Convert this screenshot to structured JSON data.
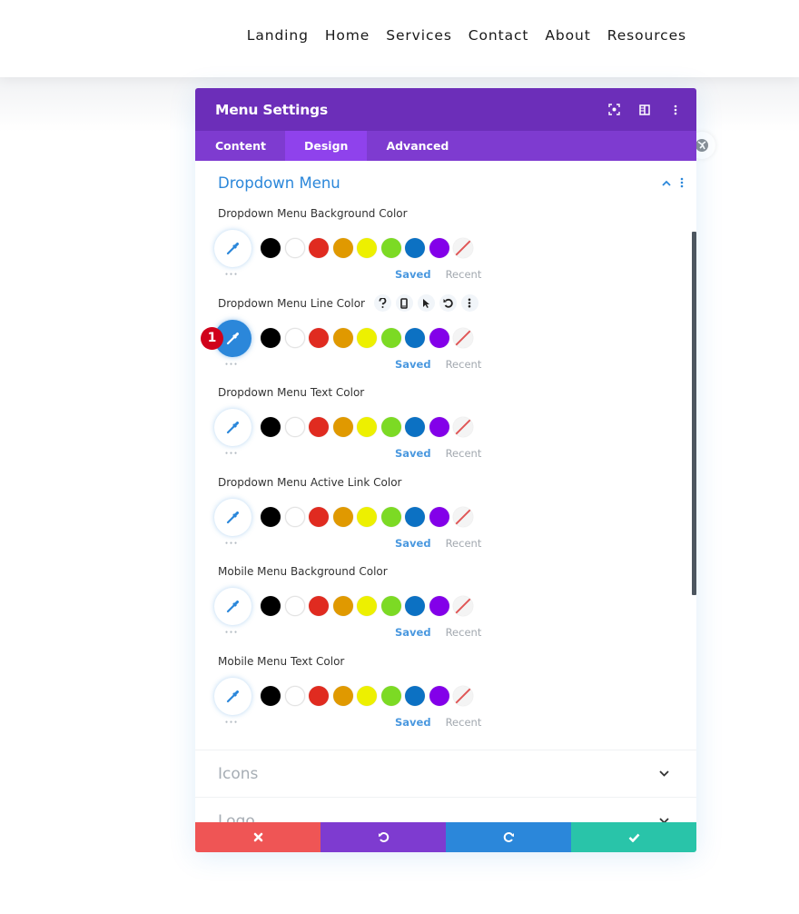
{
  "nav": {
    "items": [
      "Landing",
      "Home",
      "Services",
      "Contact",
      "About",
      "Resources"
    ]
  },
  "modal": {
    "title": "Menu Settings",
    "header_icons": [
      "focus-icon",
      "split-view-icon",
      "more-vertical-icon"
    ],
    "tabs": [
      {
        "label": "Content",
        "active": false
      },
      {
        "label": "Design",
        "active": true
      },
      {
        "label": "Advanced",
        "active": false
      }
    ],
    "section": {
      "title": "Dropdown Menu",
      "expanded": true
    },
    "palette": [
      "#000000",
      "#ffffff",
      "#e02b20",
      "#e09900",
      "#edf000",
      "#7cda24",
      "#0c71c3",
      "#8300e9",
      "none"
    ],
    "palette_tabs": {
      "saved": "Saved",
      "recent": "Recent"
    },
    "settings": [
      {
        "label": "Dropdown Menu Background Color",
        "active": false
      },
      {
        "label": "Dropdown Menu Line Color",
        "active": true,
        "badge": "1",
        "label_icons": [
          "help-icon",
          "mobile-icon",
          "cursor-icon",
          "reset-icon",
          "more-vertical-icon"
        ]
      },
      {
        "label": "Dropdown Menu Text Color",
        "active": false
      },
      {
        "label": "Dropdown Menu Active Link Color",
        "active": false
      },
      {
        "label": "Mobile Menu Background Color",
        "active": false
      },
      {
        "label": "Mobile Menu Text Color",
        "active": false
      }
    ],
    "collapsed_sections": [
      "Icons",
      "Logo"
    ],
    "footer": {
      "buttons": [
        {
          "name": "cancel",
          "color": "#ef5555"
        },
        {
          "name": "undo",
          "color": "#7e3bd0"
        },
        {
          "name": "redo",
          "color": "#2b87da"
        },
        {
          "name": "save",
          "color": "#29c4a9"
        }
      ]
    }
  },
  "colors": {
    "header": "#6c2eb9",
    "tabs": "#7e3bd0",
    "active_tab": "#8f42ec",
    "accent": "#2b87da",
    "badge": "#d0021b"
  }
}
